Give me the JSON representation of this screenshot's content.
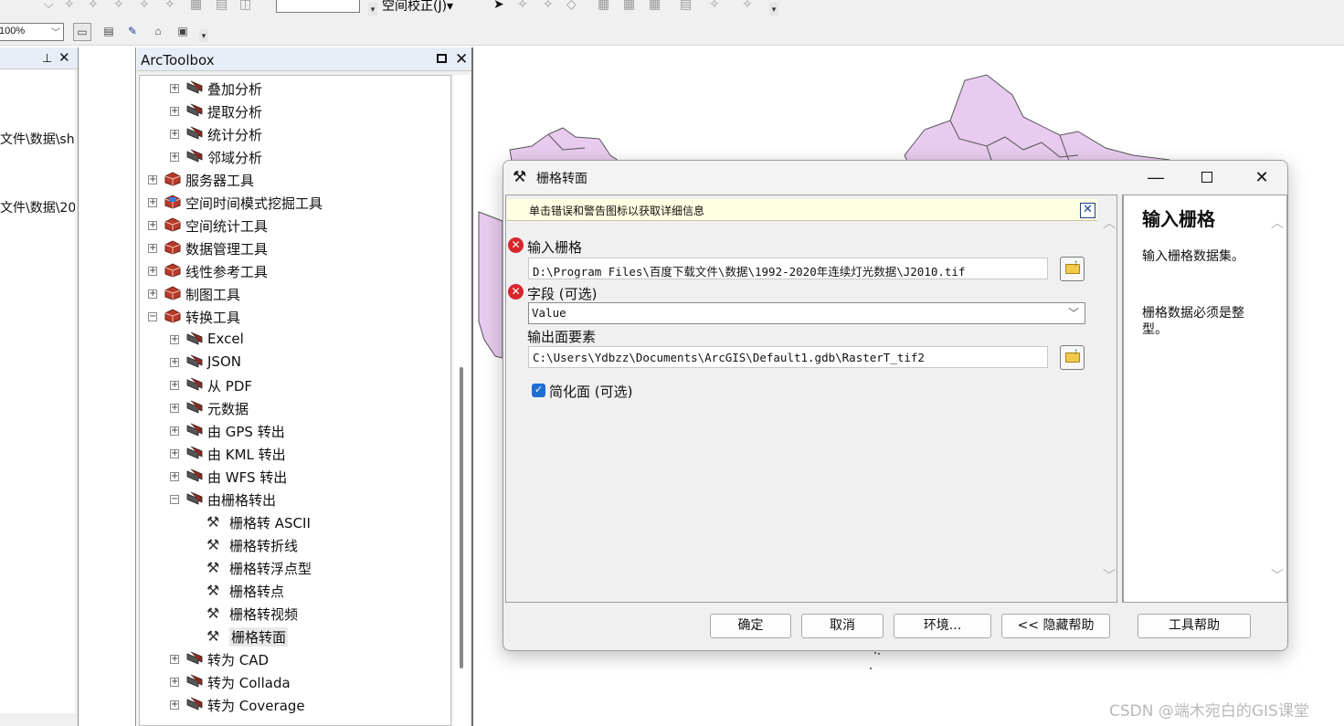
{
  "toolbar": {
    "spatial_adjust_label": "空间校正(J)▾",
    "zoom_value": "100%"
  },
  "toc": {
    "paths": [
      "文件\\数据\\shi",
      "文件\\数据\\20"
    ]
  },
  "toolbox": {
    "title": "ArcToolbox",
    "items": [
      {
        "label": "叠加分析"
      },
      {
        "label": "提取分析"
      },
      {
        "label": "统计分析"
      },
      {
        "label": "邻域分析"
      },
      {
        "label": "服务器工具"
      },
      {
        "label": "空间时间模式挖掘工具"
      },
      {
        "label": "空间统计工具"
      },
      {
        "label": "数据管理工具"
      },
      {
        "label": "线性参考工具"
      },
      {
        "label": "制图工具"
      },
      {
        "label": "转换工具"
      },
      {
        "label": "Excel"
      },
      {
        "label": "JSON"
      },
      {
        "label": "从 PDF"
      },
      {
        "label": "元数据"
      },
      {
        "label": "由 GPS 转出"
      },
      {
        "label": "由 KML 转出"
      },
      {
        "label": "由 WFS 转出"
      },
      {
        "label": "由栅格转出"
      },
      {
        "label": "栅格转 ASCII"
      },
      {
        "label": "栅格转折线"
      },
      {
        "label": "栅格转浮点型"
      },
      {
        "label": "栅格转点"
      },
      {
        "label": "栅格转视频"
      },
      {
        "label": "栅格转面"
      },
      {
        "label": "转为 CAD"
      },
      {
        "label": "转为 Collada"
      },
      {
        "label": "转为 Coverage"
      }
    ]
  },
  "dialog": {
    "title": "栅格转面",
    "message": "单击错误和警告图标以获取详细信息",
    "params": {
      "input_raster_label": "输入栅格",
      "input_raster_value": "D:\\Program Files\\百度下载文件\\数据\\1992-2020年连续灯光数据\\J2010.tif",
      "field_label": "字段 (可选)",
      "field_value": "Value",
      "output_label": "输出面要素",
      "output_value": "C:\\Users\\Ydbzz\\Documents\\ArcGIS\\Default1.gdb\\RasterT_tif2",
      "simplify_label": "简化面 (可选)"
    },
    "help": {
      "title": "输入栅格",
      "text1": "输入栅格数据集。",
      "text2": "栅格数据必须是整型。"
    },
    "buttons": {
      "ok": "确定",
      "cancel": "取消",
      "env": "环境...",
      "hide_help": "<< 隐藏帮助",
      "tool_help": "工具帮助"
    }
  },
  "watermark": "CSDN @端木宛白的GIS课堂",
  "colors": {
    "map_fill": "#e8cbee",
    "map_stroke": "#555555",
    "error_red": "#d8262c",
    "checkbox_blue": "#1f6fd1",
    "message_bg": "#ffffe1"
  }
}
